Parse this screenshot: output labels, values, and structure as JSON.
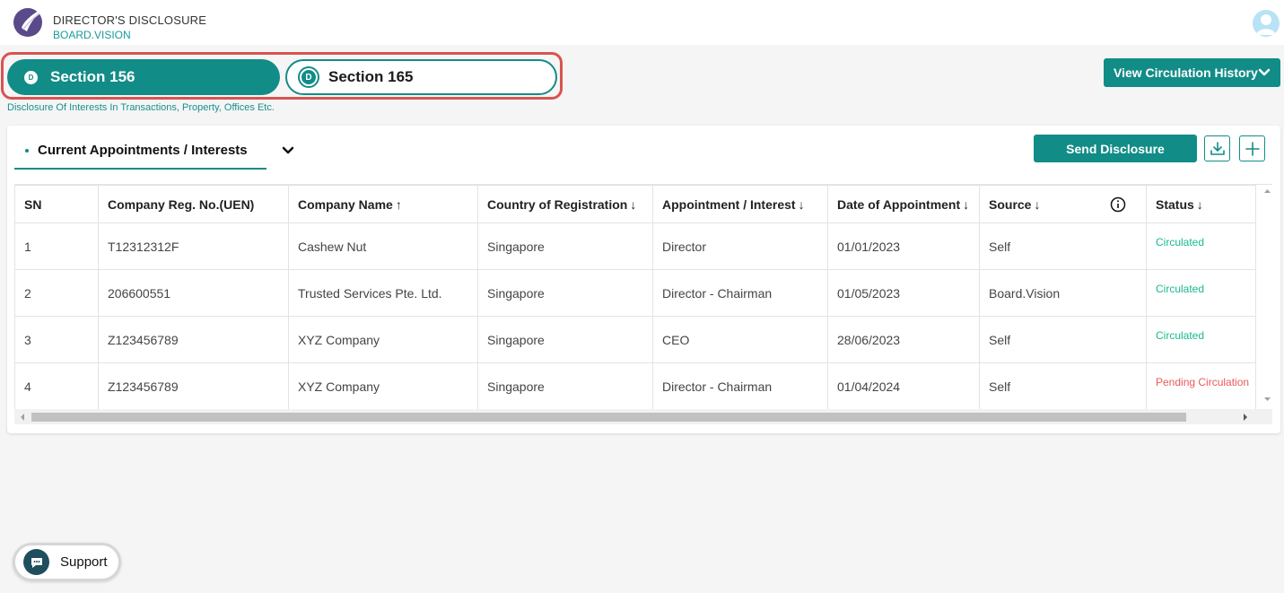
{
  "header": {
    "title": "DIRECTOR'S DISCLOSURE",
    "subtitle": "BOARD.VISION"
  },
  "sections": {
    "active": {
      "badge": "D",
      "label": "Section 156"
    },
    "inactive": {
      "badge": "D",
      "label": "Section 165"
    },
    "description": "Disclosure Of Interests In Transactions, Property, Offices Etc."
  },
  "history_button": {
    "label": "View Circulation History"
  },
  "card": {
    "tab_label": "Current Appointments / Interests",
    "send_button": "Send Disclosure"
  },
  "table": {
    "columns": [
      {
        "label": "SN",
        "arrow": ""
      },
      {
        "label": "Company Reg. No.(UEN)",
        "arrow": ""
      },
      {
        "label": "Company Name",
        "arrow": "↑"
      },
      {
        "label": "Country of Registration",
        "arrow": "↓"
      },
      {
        "label": "Appointment / Interest",
        "arrow": "↓"
      },
      {
        "label": "Date of Appointment",
        "arrow": "↓"
      },
      {
        "label": "Source",
        "arrow": "↓"
      },
      {
        "label": "Status",
        "arrow": "↓"
      }
    ],
    "rows": [
      {
        "sn": "1",
        "uen": "T12312312F",
        "company": "Cashew Nut",
        "country": "Singapore",
        "appointment": "Director",
        "date": "01/01/2023",
        "source": "Self",
        "status": "Circulated"
      },
      {
        "sn": "2",
        "uen": "206600551",
        "company": "Trusted Services Pte. Ltd.",
        "country": "Singapore",
        "appointment": "Director - Chairman",
        "date": "01/05/2023",
        "source": "Board.Vision",
        "status": "Circulated"
      },
      {
        "sn": "3",
        "uen": "Z123456789",
        "company": "XYZ Company",
        "country": "Singapore",
        "appointment": "CEO",
        "date": "28/06/2023",
        "source": "Self",
        "status": "Circulated"
      },
      {
        "sn": "4",
        "uen": "Z123456789",
        "company": "XYZ Company",
        "country": "Singapore",
        "appointment": "Director - Chairman",
        "date": "01/04/2024",
        "source": "Self",
        "status": "Pending Circulation"
      }
    ]
  },
  "support": {
    "label": "Support"
  },
  "colors": {
    "accent": "#128c87",
    "circulated": "#19b990",
    "pending": "#e85a5a",
    "highlight_border": "#d9534f"
  }
}
